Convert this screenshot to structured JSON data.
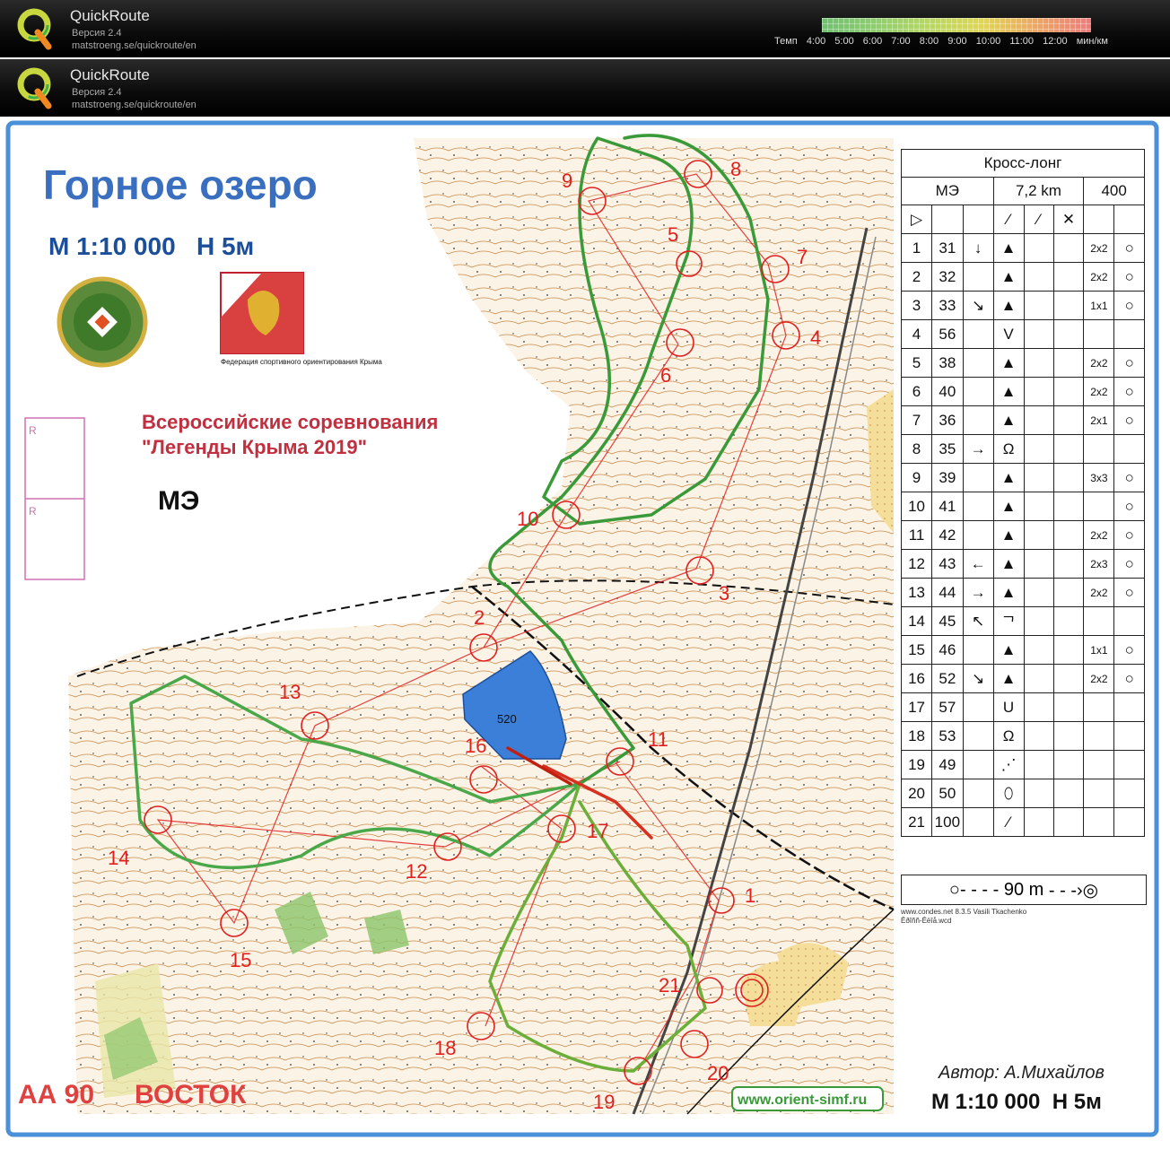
{
  "app": {
    "name": "QuickRoute",
    "version_line": "Версия 2.4",
    "url": "matstroeng.se/quickroute/en"
  },
  "pace_scale": {
    "prefix": "Темп",
    "ticks": [
      "4:00",
      "5:00",
      "6:00",
      "7:00",
      "8:00",
      "9:00",
      "10:00",
      "11:00",
      "12:00"
    ],
    "unit": "мин/км"
  },
  "map": {
    "title": "Горное озеро",
    "scale_contour": "М 1:10 000   Н 5м",
    "event_line1": "Всероссийские соревнования",
    "event_line2": "\"Легенды Крыма 2019\"",
    "class": "МЭ",
    "federation_caption": "Федерация спортивного ориентирования Крыма",
    "map_code": "АА 90",
    "region": "ВОСТОК",
    "author": "Автор: А.Михайлов",
    "scale_bottom": "М 1:10 000  Н 5м",
    "website": "www.orient-simf.ru",
    "lake_elevation": "520",
    "box_letters": [
      "R",
      "R"
    ],
    "control_numbers": [
      "1",
      "2",
      "3",
      "4",
      "5",
      "6",
      "7",
      "8",
      "9",
      "10",
      "11",
      "12",
      "13",
      "14",
      "15",
      "16",
      "17",
      "18",
      "19",
      "20",
      "21"
    ]
  },
  "legend": {
    "course_type": "Кросс-лонг",
    "class": "МЭ",
    "length": "7,2 km",
    "climb": "400",
    "rows": [
      {
        "n": "1",
        "code": "31",
        "dir": "↓",
        "feat": "▲",
        "dim": "2x2"
      },
      {
        "n": "2",
        "code": "32",
        "dir": "",
        "feat": "▲",
        "dim": "2x2"
      },
      {
        "n": "3",
        "code": "33",
        "dir": "↘",
        "feat": "▲",
        "dim": "1x1"
      },
      {
        "n": "4",
        "code": "56",
        "dir": "",
        "feat": "V",
        "dim": ""
      },
      {
        "n": "5",
        "code": "38",
        "dir": "",
        "feat": "▲",
        "dim": "2x2"
      },
      {
        "n": "6",
        "code": "40",
        "dir": "",
        "feat": "▲",
        "dim": "2x2"
      },
      {
        "n": "7",
        "code": "36",
        "dir": "",
        "feat": "▲",
        "dim": "2x1"
      },
      {
        "n": "8",
        "code": "35",
        "dir": "→",
        "feat": "Ω",
        "dim": ""
      },
      {
        "n": "9",
        "code": "39",
        "dir": "",
        "feat": "▲",
        "dim": "3x3"
      },
      {
        "n": "10",
        "code": "41",
        "dir": "",
        "feat": "▲",
        "dim": ""
      },
      {
        "n": "11",
        "code": "42",
        "dir": "",
        "feat": "▲",
        "dim": "2x2"
      },
      {
        "n": "12",
        "code": "43",
        "dir": "←",
        "feat": "▲",
        "dim": "2x3"
      },
      {
        "n": "13",
        "code": "44",
        "dir": "→",
        "feat": "▲",
        "dim": "2x2"
      },
      {
        "n": "14",
        "code": "45",
        "dir": "↖",
        "feat": "ᄀ",
        "dim": ""
      },
      {
        "n": "15",
        "code": "46",
        "dir": "",
        "feat": "▲",
        "dim": "1x1"
      },
      {
        "n": "16",
        "code": "52",
        "dir": "↘",
        "feat": "▲",
        "dim": "2x2"
      },
      {
        "n": "17",
        "code": "57",
        "dir": "",
        "feat": "U",
        "dim": ""
      },
      {
        "n": "18",
        "code": "53",
        "dir": "",
        "feat": "Ω",
        "dim": ""
      },
      {
        "n": "19",
        "code": "49",
        "dir": "",
        "feat": "⋰",
        "dim": ""
      },
      {
        "n": "20",
        "code": "50",
        "dir": "",
        "feat": "⬯",
        "dim": ""
      },
      {
        "n": "21",
        "code": "100",
        "dir": "",
        "feat": "⁄",
        "dim": ""
      }
    ],
    "finish": "90 m",
    "credit1": "www.condes.net 8.3.5 Vasili Tkachenko",
    "credit2": "Êðîññ-Êëîå.wcd"
  },
  "colors": {
    "course_red": "#e02020",
    "route_green": "#2e8b2e",
    "title_blue": "#3a6fc0",
    "lake_blue": "#3c7fd8"
  }
}
